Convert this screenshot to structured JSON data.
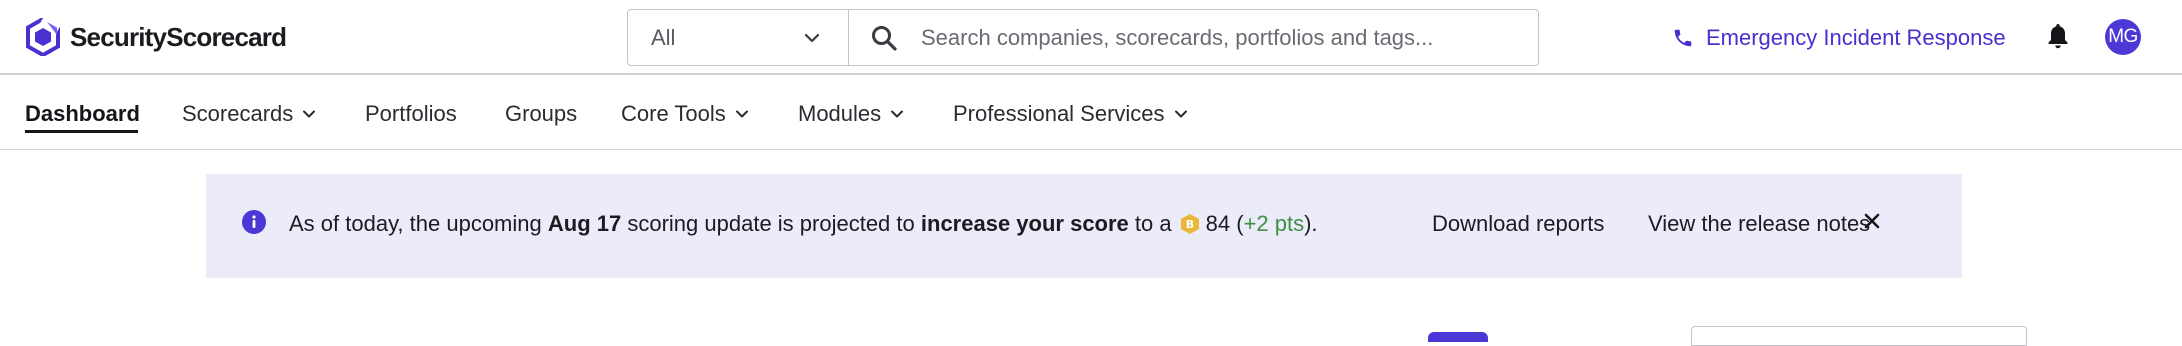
{
  "header": {
    "logo_text": "SecurityScorecard",
    "search": {
      "scope_value": "All",
      "placeholder": "Search companies, scorecards, portfolios and tags..."
    },
    "emergency_label": "Emergency Incident Response",
    "avatar_initials": "MG"
  },
  "nav": {
    "items": [
      {
        "label": "Dashboard",
        "active": true,
        "dropdown": false
      },
      {
        "label": "Scorecards",
        "dropdown": true
      },
      {
        "label": "Portfolios",
        "dropdown": false
      },
      {
        "label": "Groups",
        "dropdown": false
      },
      {
        "label": "Core Tools",
        "dropdown": true
      },
      {
        "label": "Modules",
        "dropdown": true
      },
      {
        "label": "Professional Services",
        "dropdown": true
      }
    ]
  },
  "banner": {
    "prefix": "As of today, the upcoming",
    "date": "Aug 17",
    "middle": "scoring update is projected to",
    "emphasis": "increase your score",
    "to_a": "to a",
    "grade_letter": "B",
    "score": "84",
    "open_paren": "(",
    "delta": "+2 pts",
    "close": ").",
    "download_label": "Download reports",
    "release_notes_label": "View the release notes"
  },
  "colors": {
    "brand": "#4a2fd1",
    "banner_bg": "#ecebfa",
    "grade_b": "#e8b83a",
    "delta_positive": "#3f8f3f"
  },
  "icons": [
    "logo-icon",
    "chevron-down-icon",
    "search-icon",
    "phone-icon",
    "bell-icon",
    "info-icon",
    "grade-b-icon",
    "close-icon"
  ]
}
